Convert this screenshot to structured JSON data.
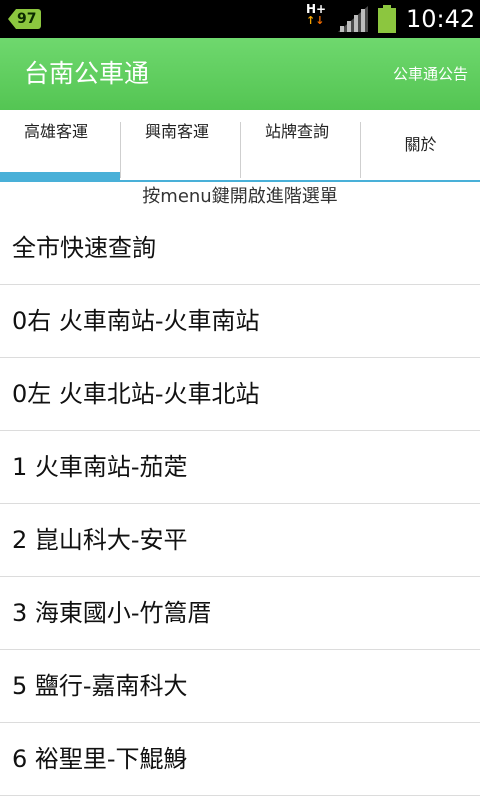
{
  "status_bar": {
    "notification_count": "97",
    "network_type": "H",
    "clock": "10:42",
    "icons": [
      "signal-icon",
      "battery-icon"
    ]
  },
  "app_bar": {
    "title": "台南公車通",
    "announcement": "公車通公告",
    "color": "#5ccd5b"
  },
  "tabs": [
    {
      "label": "高雄客運",
      "selected": true
    },
    {
      "label": "興南客運",
      "selected": false
    },
    {
      "label": "站牌查詢",
      "selected": false
    },
    {
      "label": "關於",
      "selected": false
    }
  ],
  "hint": "按menu鍵開啟進階選單",
  "routes": [
    "全市快速查詢",
    "0右 火車南站-火車南站",
    "0左 火車北站-火車北站",
    "1 火車南站-茄萣",
    "2 崑山科大-安平",
    "3 海東國小-竹篙厝",
    "5 鹽行-嘉南科大",
    "6 裕聖里-下鯤鯓"
  ],
  "colors": {
    "accent": "#49b0d8",
    "status_bar": "#000000",
    "battery": "#8cc63f"
  }
}
